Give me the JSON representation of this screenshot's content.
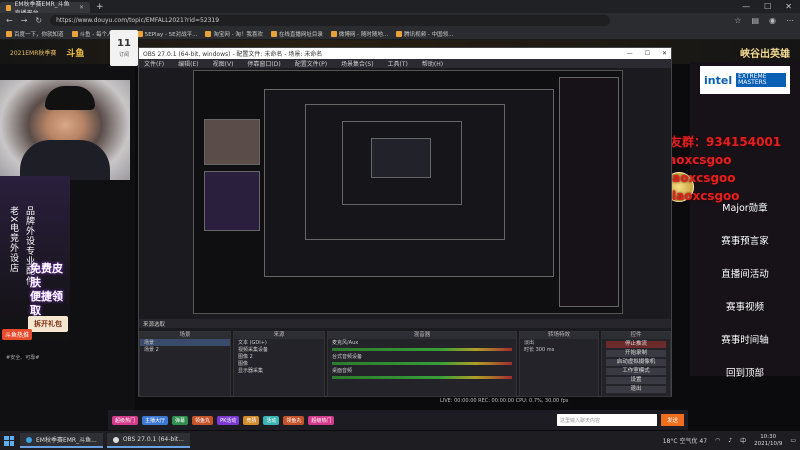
{
  "browser": {
    "tabs": [
      {
        "label": "EM秋季赛EMR_斗鱼直播平台"
      }
    ],
    "url": "https://www.douyu.com/topic/EMFALL2021?rid=52319",
    "bookmarks": [
      "百度一下，你就知道",
      "斗鱼 - 每个人的直...",
      "5EPlay - 5E对战平...",
      "淘宝网 - 淘！我喜欢",
      "在线直播网址目录",
      "微博网 - 随时随地...",
      "腾讯视频 - 中国领..."
    ]
  },
  "site": {
    "logo": "斗鱼",
    "title": "2021EMR秋季赛",
    "crest": "峽谷出英雄",
    "follow_num": "11",
    "follow_sub": "订阅"
  },
  "promo": {
    "vert1": "老X电竞外设店",
    "vert2": "品牌外设专业配件",
    "headline1": "免费皮肤",
    "headline2": "便捷领取",
    "button": "拆开礼包",
    "logo": "斗鱼热推",
    "foot": "#安全、可靠#"
  },
  "rightpanel": {
    "intel": "intel",
    "intel_sub": "EXTREME MASTERS",
    "watermark": [
      "水友群：934154001",
      "laoxcsgoo",
      "laoxcsgoo",
      "laoxcsgoo"
    ],
    "menu": [
      "Major勋章",
      "赛事预言家",
      "直播间活动",
      "赛事视频",
      "赛事时间轴",
      "回到顶部"
    ]
  },
  "obs": {
    "title": "OBS 27.0.1 (64-bit, windows) - 配置文件: 未命名 - 场景: 未命名",
    "menu": [
      "文件(F)",
      "编辑(E)",
      "视图(V)",
      "停靠窗口(D)",
      "配置文件(P)",
      "场景集合(S)",
      "工具(T)",
      "帮助(H)"
    ],
    "scene_bar": "来源选取",
    "docks": {
      "scenes": {
        "title": "场景",
        "items": [
          "场景",
          "场景 2"
        ]
      },
      "sources": {
        "title": "来源",
        "items": [
          "文本 (GDI+)",
          "视频采集设备",
          "图像 2",
          "图像",
          "显示器采集"
        ]
      },
      "mixer": {
        "title": "混音器",
        "items": [
          "麦克风/Aux",
          "台式音频设备",
          "桌面音频"
        ]
      },
      "transitions": {
        "title": "转场特效",
        "items": [
          "淡出",
          "时长  300 ms"
        ]
      },
      "controls": {
        "title": "控件",
        "items": [
          "停止推流",
          "开始录制",
          "启动虚拟摄像机",
          "工作室模式",
          "设置",
          "退出"
        ]
      }
    },
    "status": "LIVE: 00:00:00   REC: 00:00:00   CPU: 0.7%, 30.00 fps"
  },
  "chat": {
    "chips": [
      "超级热门",
      "主播大厅",
      "弹幕",
      "领鱼丸",
      "PK活动",
      "竞猜",
      "活动",
      "领鱼丸",
      "超级热门"
    ],
    "placeholder": "这里输入聊天内容",
    "send": "发送"
  },
  "taskbar": {
    "items": [
      "EM秋季赛EMR_斗鱼...",
      "OBS 27.0.1 (64-bit..."
    ],
    "weather": "18°C 空气优 47",
    "time": "10:30",
    "date": "2021/10/9"
  }
}
